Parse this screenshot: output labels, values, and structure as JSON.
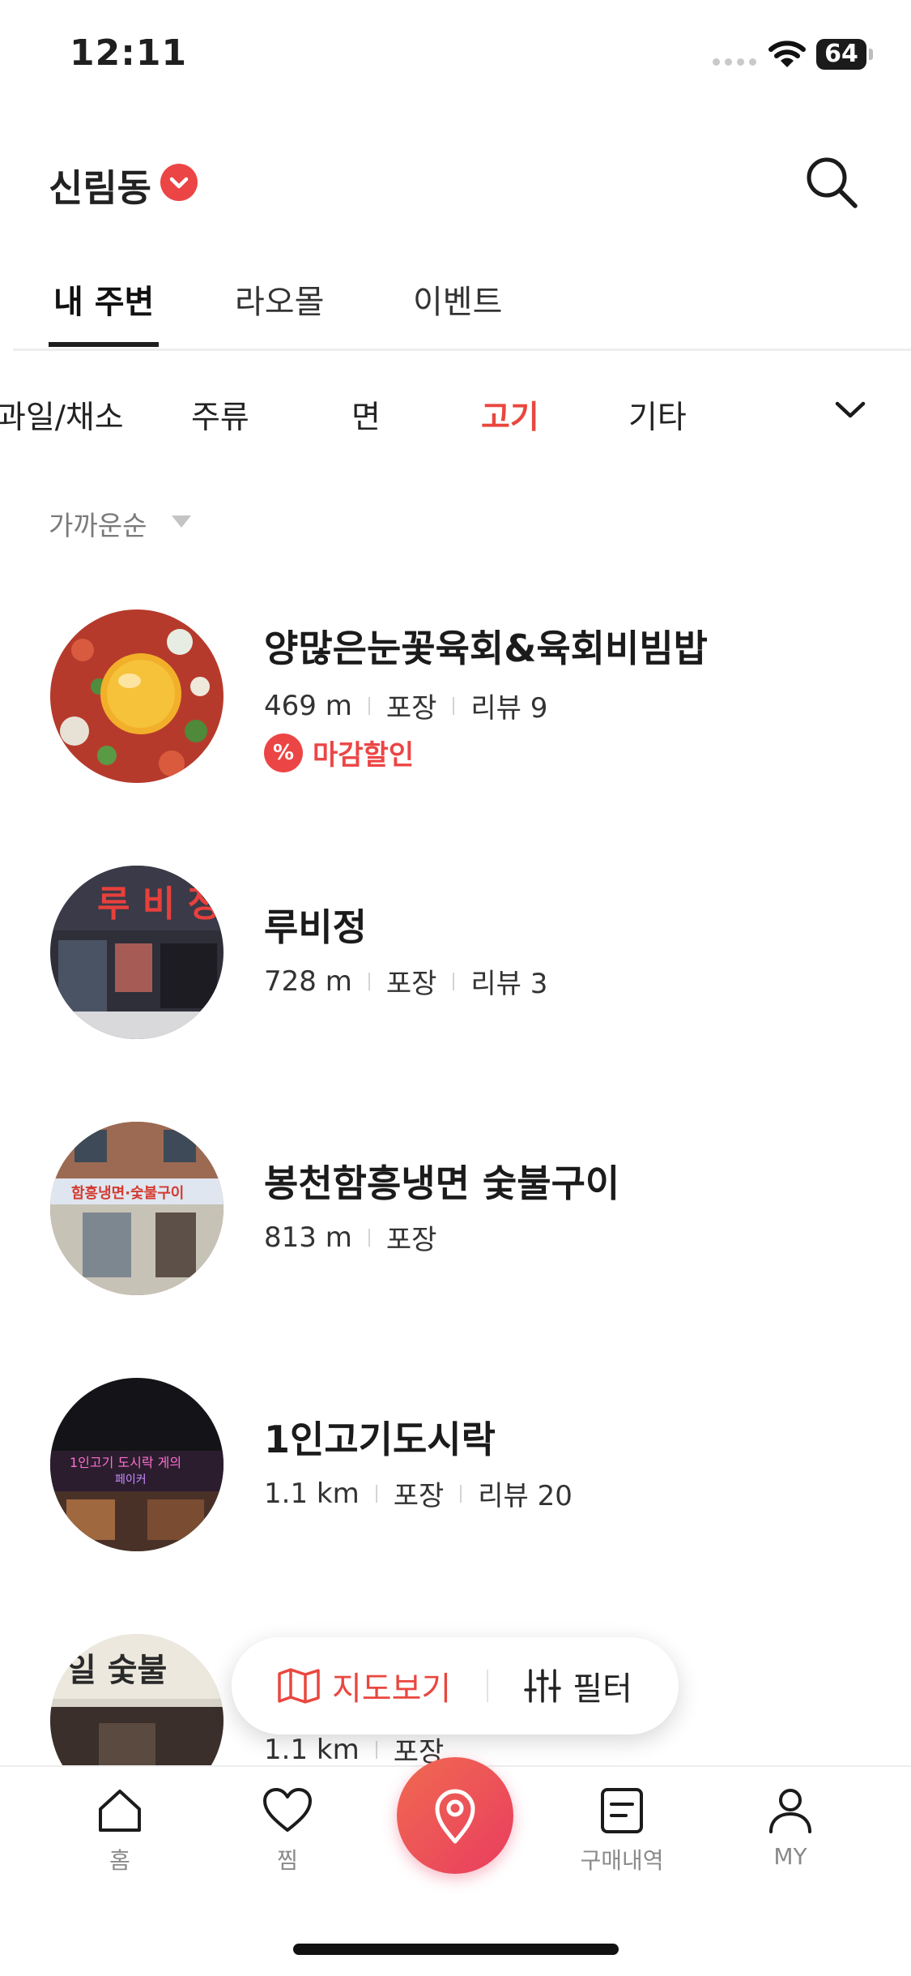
{
  "status_bar": {
    "time": "12:11",
    "battery": "64"
  },
  "header": {
    "location": "신림동"
  },
  "tabs": [
    {
      "label": "내 주변",
      "active": true
    },
    {
      "label": "라오몰",
      "active": false
    },
    {
      "label": "이벤트",
      "active": false
    }
  ],
  "categories": [
    {
      "label": "과일/채소",
      "active": false
    },
    {
      "label": "주류",
      "active": false
    },
    {
      "label": "면",
      "active": false
    },
    {
      "label": "고기",
      "active": true
    },
    {
      "label": "기타",
      "active": false
    }
  ],
  "sort": {
    "label": "가까운순"
  },
  "stores": [
    {
      "name": "양많은눈꽃육회&육회비빔밥",
      "distance": "469 m",
      "pickup": "포장",
      "review": "리뷰 9",
      "discount": "마감할인",
      "discount_icon": "%"
    },
    {
      "name": "루비정",
      "distance": "728 m",
      "pickup": "포장",
      "review": "리뷰 3"
    },
    {
      "name": "봉천함흥냉면 숯불구이",
      "distance": "813 m",
      "pickup": "포장"
    },
    {
      "name": "1인고기도시락",
      "distance": "1.1 km",
      "pickup": "포장",
      "review": "리뷰 20"
    },
    {
      "distance": "1.1 km",
      "pickup": "포장"
    }
  ],
  "floating": {
    "map_label": "지도보기",
    "filter_label": "필터"
  },
  "bottom_nav": [
    {
      "label": "홈",
      "icon": "home-icon"
    },
    {
      "label": "찜",
      "icon": "heart-icon"
    },
    {
      "label": "",
      "icon": "location-pin-icon"
    },
    {
      "label": "구매내역",
      "icon": "receipt-icon"
    },
    {
      "label": "MY",
      "icon": "person-icon"
    }
  ],
  "colors": {
    "accent": "#e9473f",
    "badge": "#ec4545",
    "text": "#1f1f1f",
    "muted": "#8a8a8a"
  }
}
